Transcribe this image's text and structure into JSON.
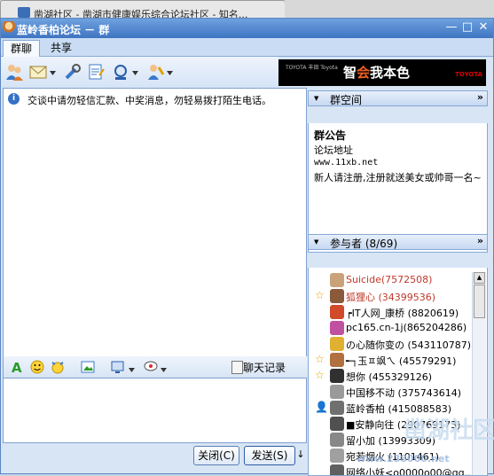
{
  "browser_tab": {
    "title": "凿湖社区 - 凿湖市健康娱乐综合论坛社区 - 知名..."
  },
  "window": {
    "title": "蓝岭香柏论坛 － 群"
  },
  "tabs": [
    {
      "label": "群聊"
    },
    {
      "label": "共享"
    }
  ],
  "toolbar": {
    "icons": [
      "members-icon",
      "mail-icon",
      "tools-icon",
      "note-icon",
      "settings-icon",
      "invite-icon"
    ]
  },
  "banner": {
    "slogan_pre": "智",
    "slogan_hl": "会",
    "slogan_post": "我本色",
    "brand": "TOYOTA",
    "brand_left": "TOYOTA 丰田 Toyota"
  },
  "chat": {
    "notice": "交谈中请勿轻信汇款、中奖消息，勿轻易拨打陌生电话。"
  },
  "input_toolbar": {
    "history_label": "聊天记录"
  },
  "buttons": {
    "close": "关闭(C)",
    "send": "发送(S)"
  },
  "group_space": {
    "header": "群空间",
    "announcement_title": "群公告",
    "forum_label": "论坛地址",
    "forum_url": "www.11xb.net",
    "notice": "新人请注册,注册就送美女或帅哥一名~"
  },
  "members": {
    "header": "参与者 (8/69)",
    "list": [
      {
        "name": "Suicide(7572508)",
        "color": "#c0392b",
        "star": false,
        "avatar": "#caa27a"
      },
      {
        "name": "狐狸心 (34399536)",
        "color": "#c0392b",
        "star": true,
        "avatar": "#8a5a3a"
      },
      {
        "name": "┍IT人网_康桥 (8820619)",
        "color": "#000000",
        "star": false,
        "avatar": "#d14a2a"
      },
      {
        "name": "pc165.cn-1j(865204286)",
        "color": "#000000",
        "star": false,
        "avatar": "#c050a0"
      },
      {
        "name": "の心随你变の (543110787)",
        "color": "#000000",
        "star": false,
        "avatar": "#e0b030"
      },
      {
        "name": "╾┐玉ㅍ飒ㄟ (45579291)",
        "color": "#000000",
        "star": true,
        "avatar": "#b07040"
      },
      {
        "name": "想你 (455329126)",
        "color": "#000000",
        "star": true,
        "avatar": "#303030"
      },
      {
        "name": "中国移不动 (375743614)",
        "color": "#000000",
        "star": false,
        "avatar": "#9a9a9a"
      },
      {
        "name": "蓝岭香柏 (415088583)",
        "color": "#000000",
        "star": false,
        "avatar": "#707070",
        "admin": true
      },
      {
        "name": "■安静向往 (290769173)",
        "color": "#000000",
        "star": false,
        "avatar": "#505050"
      },
      {
        "name": "留小加 (13993309)",
        "color": "#000000",
        "star": false,
        "avatar": "#888888"
      },
      {
        "name": "宛若烟火 (1101461)",
        "color": "#000000",
        "star": false,
        "avatar": "#a0a0a0"
      },
      {
        "name": "网络小妖<o0000o00@qq...",
        "color": "#000000",
        "star": false,
        "avatar": "#606060"
      }
    ]
  },
  "watermark": {
    "text": "凿湖社区",
    "url": "www.238000.net"
  }
}
